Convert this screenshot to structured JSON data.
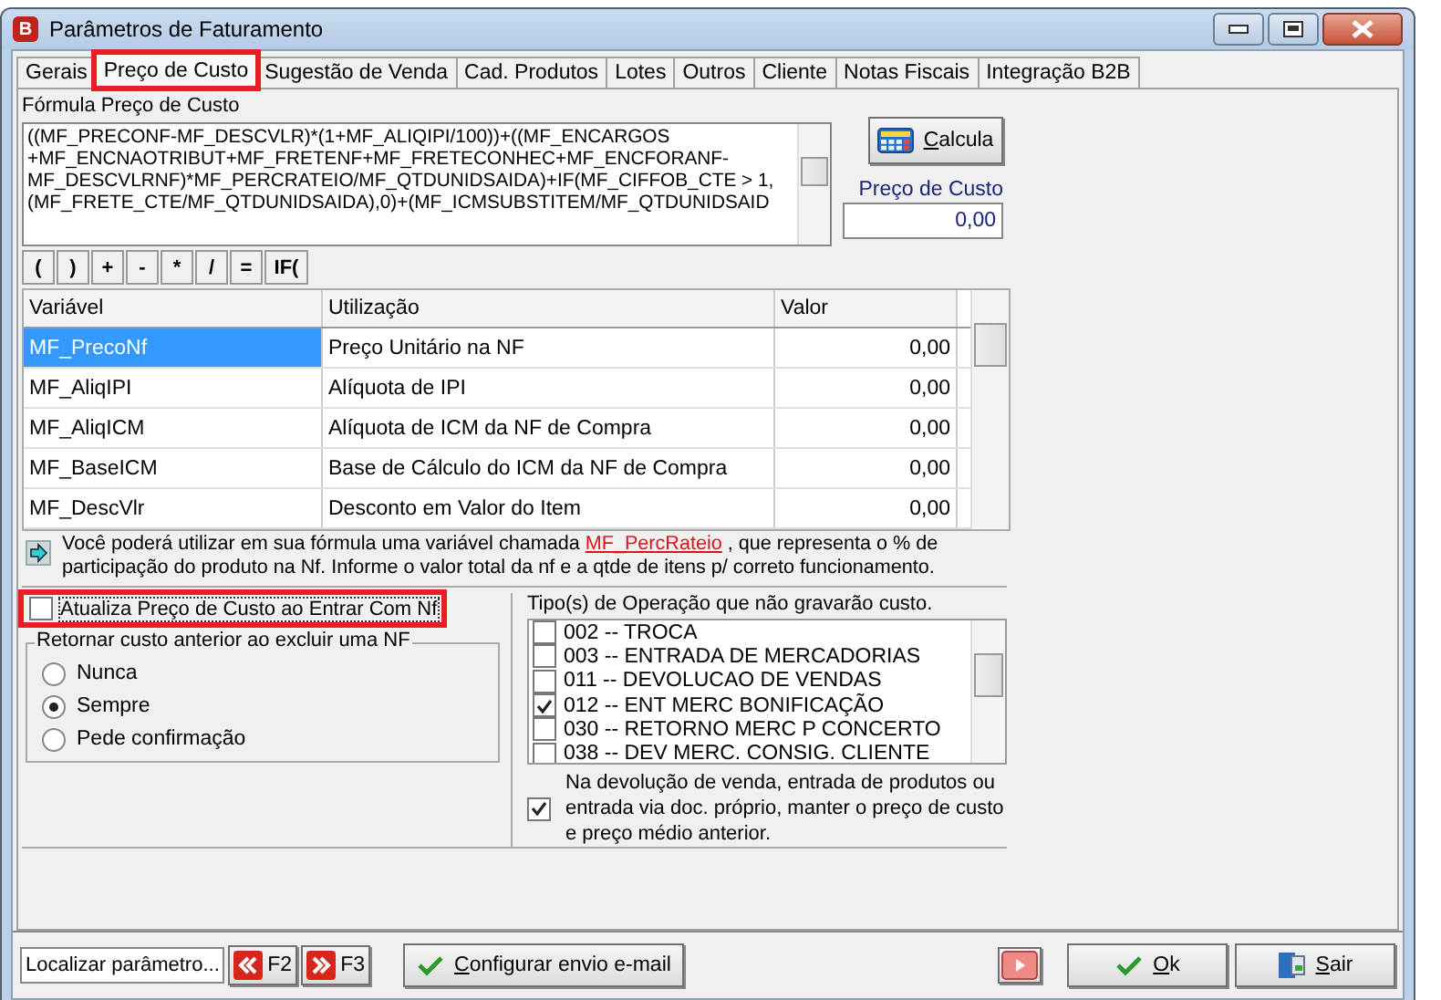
{
  "window": {
    "title": "Parâmetros de Faturamento",
    "logo": "B"
  },
  "tabs": [
    {
      "label": "Gerais",
      "selected": false,
      "highlighted": false
    },
    {
      "label": "Preço de Custo",
      "selected": true,
      "highlighted": true
    },
    {
      "label": "Sugestão de  Venda",
      "selected": false,
      "highlighted": false
    },
    {
      "label": "Cad. Produtos",
      "selected": false,
      "highlighted": false
    },
    {
      "label": "Lotes",
      "selected": false,
      "highlighted": false
    },
    {
      "label": "Outros",
      "selected": false,
      "highlighted": false
    },
    {
      "label": "Cliente",
      "selected": false,
      "highlighted": false
    },
    {
      "label": "Notas Fiscais",
      "selected": false,
      "highlighted": false
    },
    {
      "label": "Integração B2B",
      "selected": false,
      "highlighted": false
    }
  ],
  "formula": {
    "label": "Fórmula Preço de Custo",
    "lines": [
      "((MF_PRECONF-MF_DESCVLR)*(1+MF_ALIQIPI/100))+((MF_ENCARGOS",
      "+MF_ENCNAOTRIBUT+MF_FRETENF+MF_FRETECONHEC+MF_ENCFORANF-",
      "MF_DESCVLRNF)*MF_PERCRATEIO/MF_QTDUNIDSAIDA)+IF(MF_CIFFOB_CTE > 1,",
      "(MF_FRETE_CTE/MF_QTDUNIDSAIDA),0)+(MF_ICMSUBSTITEM/MF_QTDUNIDSAID"
    ]
  },
  "calculate_button": "Calcula",
  "cost": {
    "label": "Preço de Custo",
    "value": "0,00"
  },
  "operators": [
    "(",
    ")",
    "+",
    "-",
    "*",
    "/",
    "=",
    "IF("
  ],
  "variables": {
    "columns": [
      "Variável",
      "Utilização",
      "Valor"
    ],
    "rows": [
      {
        "name": "MF_PrecoNf",
        "usage": "Preço Unitário na NF",
        "value": "0,00",
        "selected": true
      },
      {
        "name": "MF_AliqIPI",
        "usage": "Alíquota de IPI",
        "value": "0,00",
        "selected": false
      },
      {
        "name": "MF_AliqICM",
        "usage": "Alíquota de ICM da NF de Compra",
        "value": "0,00",
        "selected": false
      },
      {
        "name": "MF_BaseICM",
        "usage": "Base de Cálculo do ICM da NF de Compra",
        "value": "0,00",
        "selected": false
      },
      {
        "name": "MF_DescVlr",
        "usage": "Desconto em Valor do Item",
        "value": "0,00",
        "selected": false
      }
    ]
  },
  "info": {
    "before": "Você poderá utilizar em sua fórmula uma variável chamada ",
    "link": "MF_PercRateio",
    "after": " , que representa o % de participação do produto na Nf. Informe o valor total da nf e a qtde de itens p/ correto funcionamento."
  },
  "update_cost": {
    "label": "Atualiza Preço de Custo ao Entrar Com Nf",
    "checked": false,
    "highlighted": true
  },
  "restore_group": {
    "title": "Retornar custo anterior ao excluir uma NF",
    "options": [
      {
        "label": "Nunca",
        "selected": false
      },
      {
        "label": "Sempre",
        "selected": true
      },
      {
        "label": "Pede confirmação",
        "selected": false
      }
    ]
  },
  "operations": {
    "label": "Tipo(s) de Operação que não gravarão custo.",
    "items": [
      {
        "label": "002 -- TROCA",
        "checked": false
      },
      {
        "label": "003 -- ENTRADA DE MERCADORIAS",
        "checked": false
      },
      {
        "label": "011 -- DEVOLUCAO DE VENDAS",
        "checked": false
      },
      {
        "label": "012 -- ENT MERC BONIFICAÇÃO",
        "checked": true
      },
      {
        "label": "030 -- RETORNO  MERC P CONCERTO",
        "checked": false
      },
      {
        "label": "038 -- DEV MERC. CONSIG. CLIENTE",
        "checked": false
      }
    ]
  },
  "keep_cost": {
    "label": "Na devolução de venda, entrada de produtos ou entrada via doc. próprio, manter o preço de custo e preço médio anterior.",
    "checked": true
  },
  "footer": {
    "search_placeholder": "Localizar parâmetro...",
    "prev": "F2",
    "next": "F3",
    "email_button": "Configurar envio e-mail",
    "ok": "Ok",
    "exit": "Sair"
  }
}
